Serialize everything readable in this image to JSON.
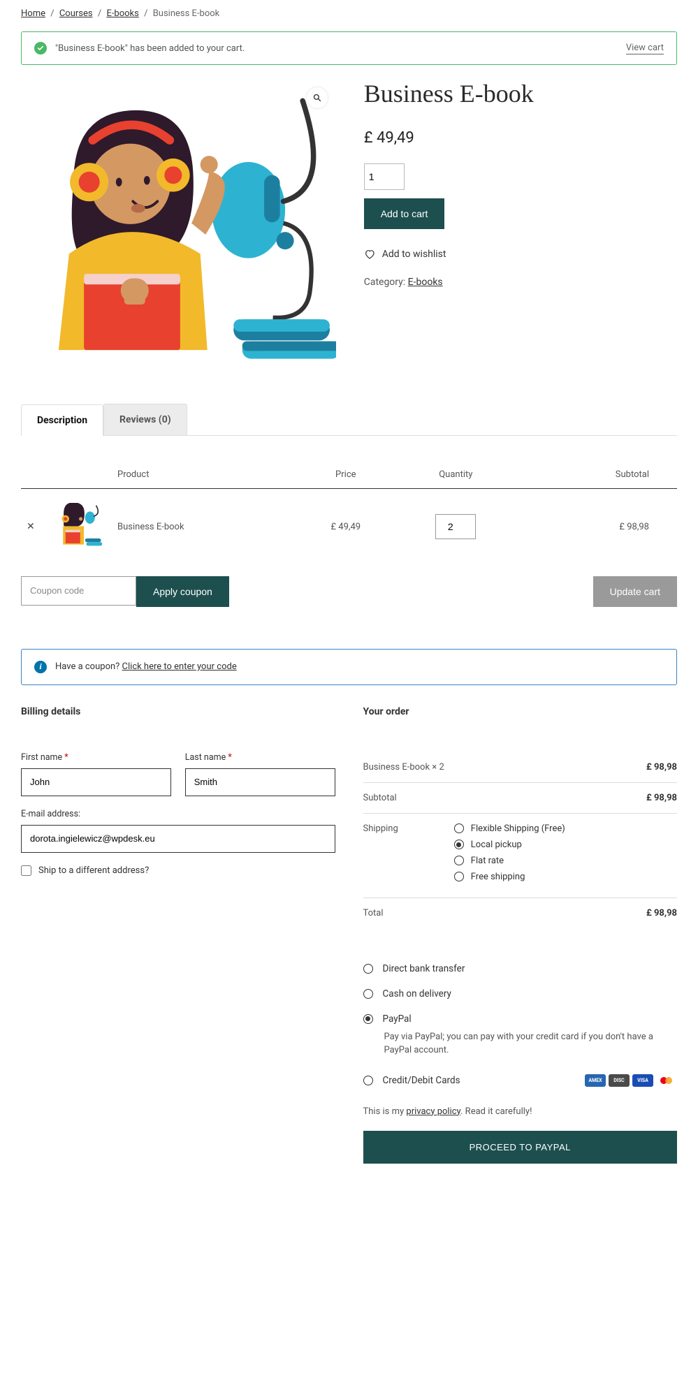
{
  "breadcrumb": {
    "home": "Home",
    "courses": "Courses",
    "ebooks": "E-books",
    "current": "Business E-book"
  },
  "notice": {
    "message": "\"Business E-book\" has been added to your cart.",
    "link": "View cart"
  },
  "product": {
    "title": "Business E-book",
    "price": "£ 49,49",
    "qty": "1",
    "add_to_cart": "Add to cart",
    "wishlist": "Add to wishlist",
    "category_label": "Category: ",
    "category_link": "E-books"
  },
  "tabs": {
    "description": "Description",
    "reviews": "Reviews (0)"
  },
  "cart": {
    "headers": {
      "product": "Product",
      "price": "Price",
      "quantity": "Quantity",
      "subtotal": "Subtotal"
    },
    "item": {
      "name": "Business E-book",
      "price": "£ 49,49",
      "qty": "2",
      "subtotal": "£ 98,98"
    },
    "coupon_placeholder": "Coupon code",
    "apply_coupon": "Apply coupon",
    "update_cart": "Update cart"
  },
  "coupon_info": {
    "text": "Have a coupon? ",
    "link": "Click here to enter your code"
  },
  "checkout": {
    "billing_title": "Billing details",
    "first_name_label": "First name ",
    "first_name_value": "John",
    "last_name_label": "Last name ",
    "last_name_value": "Smith",
    "email_label": "E-mail address:",
    "email_value": "dorota.ingielewicz@wpdesk.eu",
    "ship_diff": "Ship to a different address?",
    "order_title": "Your order",
    "line_item": "Business E-book  × 2",
    "line_total": "£ 98,98",
    "subtotal_label": "Subtotal",
    "subtotal_value": "£ 98,98",
    "shipping_label": "Shipping",
    "shipping_opts": {
      "flexible": "Flexible Shipping (Free)",
      "local": "Local pickup",
      "flat": "Flat rate",
      "free": "Free shipping"
    },
    "total_label": "Total",
    "total_value": "£ 98,98"
  },
  "payment": {
    "bank": "Direct bank transfer",
    "cod": "Cash on delivery",
    "paypal": "PayPal",
    "paypal_desc": "Pay via PayPal; you can pay with your credit card if you don't have a PayPal account.",
    "cc": "Credit/Debit Cards",
    "privacy_pre": "This is my ",
    "privacy_link": "privacy policy",
    "privacy_post": ". Read it carefully!",
    "proceed": "PROCEED TO PAYPAL"
  }
}
